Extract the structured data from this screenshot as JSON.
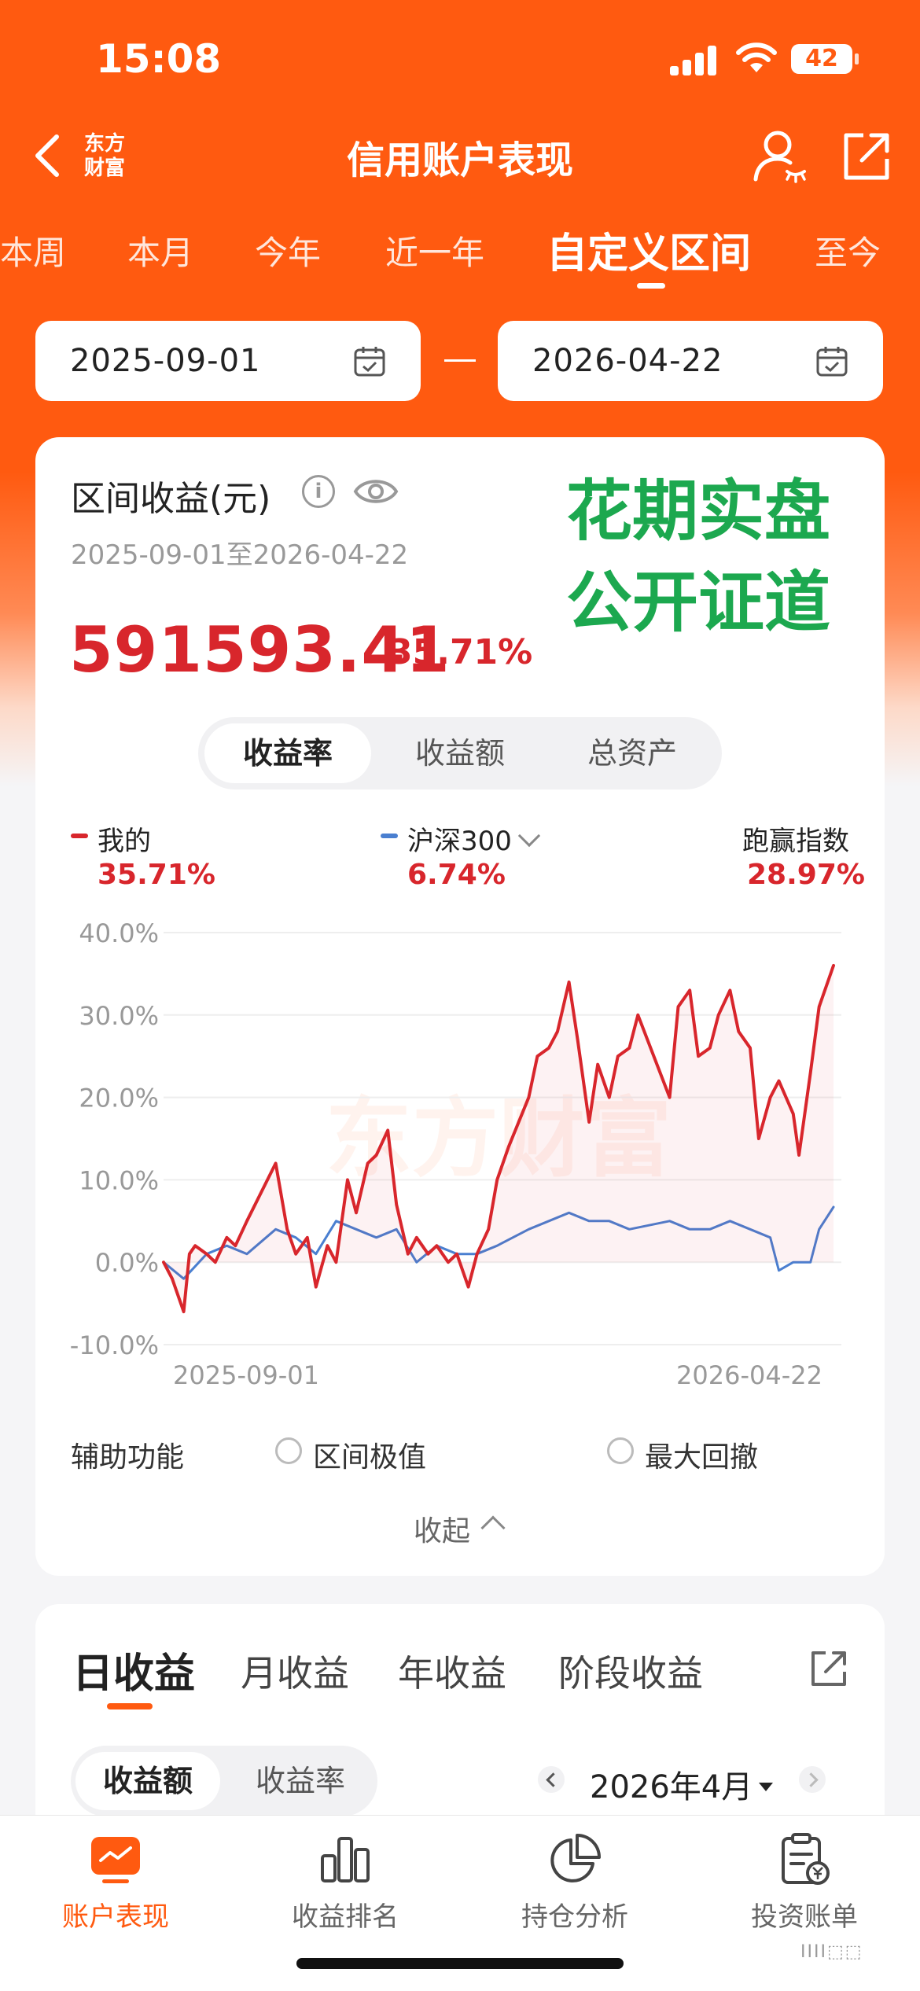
{
  "status_bar": {
    "time": "15:08",
    "battery": "42",
    "battery_level": 0.42
  },
  "nav": {
    "logo_line1": "东方",
    "logo_line2": "财富",
    "title": "信用账户表现"
  },
  "periods": [
    {
      "label": "本周"
    },
    {
      "label": "本月"
    },
    {
      "label": "今年"
    },
    {
      "label": "近一年"
    },
    {
      "label": "自定义区间"
    },
    {
      "label": "至今"
    }
  ],
  "date_range": {
    "start": "2025-09-01",
    "end": "2026-04-22"
  },
  "summary": {
    "title": "区间收益(元)",
    "info_glyph": "i",
    "range_text": "2025-09-01至2026-04-22",
    "profit": "591593.41",
    "profit_pct": "35.71%",
    "overlay_line1": "花期实盘",
    "overlay_line2": "公开证道"
  },
  "metric_tabs": [
    "收益率",
    "收益额",
    "总资产"
  ],
  "legend": {
    "mine": {
      "name": "我的",
      "value": "35.71%"
    },
    "index": {
      "name": "沪深300",
      "value": "6.74%"
    },
    "beat": {
      "name": "跑赢指数",
      "value": "28.97%"
    }
  },
  "colors": {
    "accent": "#ff5a10",
    "mine": "#d8262c",
    "index": "#4a7fd0",
    "green_text": "#1ca84f"
  },
  "chart_data": {
    "type": "line",
    "y_ticks": [
      "40.0%",
      "30.0%",
      "20.0%",
      "10.0%",
      "0.0%",
      "-10.0%"
    ],
    "ylim": [
      -10,
      40
    ],
    "xlim": [
      "2025-09-01",
      "2026-04-22"
    ],
    "x_tick_labels": [
      "2025-09-01",
      "2026-04-22"
    ],
    "watermark": "东方财富",
    "grid": true,
    "series": [
      {
        "name": "我的",
        "x": [
          "2025-09-01",
          "2025-09-04",
          "2025-09-08",
          "2025-09-10",
          "2025-09-12",
          "2025-09-16",
          "2025-09-19",
          "2025-09-23",
          "2025-09-26",
          "2025-09-30",
          "2025-10-10",
          "2025-10-14",
          "2025-10-17",
          "2025-10-21",
          "2025-10-24",
          "2025-10-28",
          "2025-10-31",
          "2025-11-04",
          "2025-11-07",
          "2025-11-11",
          "2025-11-14",
          "2025-11-18",
          "2025-11-21",
          "2025-11-25",
          "2025-11-28",
          "2025-12-02",
          "2025-12-05",
          "2025-12-09",
          "2025-12-12",
          "2025-12-16",
          "2025-12-19",
          "2025-12-23",
          "2025-12-26",
          "2025-12-30",
          "2026-01-06",
          "2026-01-09",
          "2026-01-13",
          "2026-01-16",
          "2026-01-20",
          "2026-01-23",
          "2026-01-27",
          "2026-01-30",
          "2026-02-03",
          "2026-02-06",
          "2026-02-10",
          "2026-02-13",
          "2026-02-24",
          "2026-02-27",
          "2026-03-03",
          "2026-03-06",
          "2026-03-10",
          "2026-03-13",
          "2026-03-17",
          "2026-03-20",
          "2026-03-24",
          "2026-03-27",
          "2026-03-31",
          "2026-04-03",
          "2026-04-08",
          "2026-04-10",
          "2026-04-14",
          "2026-04-17",
          "2026-04-22"
        ],
        "y": [
          0,
          -2,
          -6,
          1,
          2,
          1,
          0,
          3,
          2,
          5,
          12,
          4,
          1,
          3,
          -3,
          2,
          0,
          10,
          6,
          12,
          13,
          16,
          7,
          1,
          3,
          1,
          2,
          0,
          1,
          -3,
          1,
          4,
          10,
          14,
          20,
          25,
          26,
          28,
          34,
          27,
          17,
          24,
          20,
          25,
          26,
          30,
          20,
          31,
          33,
          25,
          26,
          30,
          33,
          28,
          26,
          15,
          20,
          22,
          18,
          13,
          23,
          31,
          36
        ]
      },
      {
        "name": "沪深300",
        "x": [
          "2025-09-01",
          "2025-09-08",
          "2025-09-16",
          "2025-09-23",
          "2025-09-30",
          "2025-10-10",
          "2025-10-17",
          "2025-10-24",
          "2025-10-31",
          "2025-11-07",
          "2025-11-14",
          "2025-11-21",
          "2025-11-28",
          "2025-12-05",
          "2025-12-12",
          "2025-12-19",
          "2025-12-26",
          "2026-01-06",
          "2026-01-13",
          "2026-01-20",
          "2026-01-27",
          "2026-02-03",
          "2026-02-10",
          "2026-02-24",
          "2026-03-03",
          "2026-03-10",
          "2026-03-17",
          "2026-03-24",
          "2026-03-31",
          "2026-04-03",
          "2026-04-08",
          "2026-04-14",
          "2026-04-17",
          "2026-04-22"
        ],
        "y": [
          0,
          -2,
          1,
          2,
          1,
          4,
          3,
          1,
          5,
          4,
          3,
          4,
          0,
          2,
          1,
          1,
          2,
          4,
          5,
          6,
          5,
          5,
          4,
          5,
          4,
          4,
          5,
          4,
          3,
          -1,
          0,
          0,
          4,
          6.7
        ]
      }
    ]
  },
  "helpers": {
    "label": "辅助功能",
    "option1": "区间极值",
    "option2": "最大回撤",
    "collapse": "收起"
  },
  "returns_tabs": [
    "日收益",
    "月收益",
    "年收益",
    "阶段收益"
  ],
  "returns_metric": [
    "收益额",
    "收益率"
  ],
  "month": "2026年4月",
  "tabbar": [
    "账户表现",
    "收益排名",
    "持仓分析",
    "投资账单"
  ],
  "corner_badge": "IIII⬚⬚"
}
